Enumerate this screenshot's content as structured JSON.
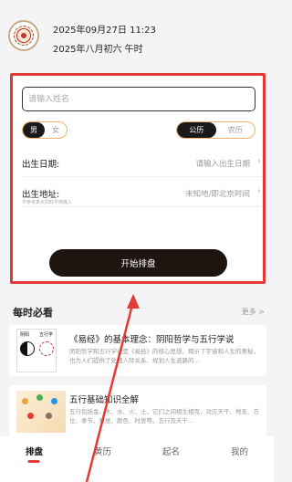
{
  "header": {
    "date_solar": "2025年09月27日 11:23",
    "date_lunar": "2025年八月初六 午时"
  },
  "form": {
    "name_placeholder": "请输入姓名",
    "gender": {
      "options": [
        "男",
        "女"
      ],
      "selected": "男"
    },
    "calendar": {
      "options": [
        "公历",
        "农历"
      ],
      "selected": "公历"
    },
    "birth_date": {
      "label": "出生日期:",
      "value": "请输入出生日期"
    },
    "birth_place": {
      "label": "出生地址:",
      "hint": "不参考真太阳时不用输入",
      "value": "未知地/即北京时间"
    },
    "submit_label": "开始排盘"
  },
  "section": {
    "title": "每时必看",
    "more_label": "更多 >"
  },
  "articles": [
    {
      "thumb_labels": [
        "阴阳",
        "五行学"
      ],
      "title": "《易经》的基本理念：阴阳哲学与五行学说",
      "desc": "阴阳哲学和五行学说是《易经》的核心思想，揭示了宇宙和人生的奥秘，也为人们提供了处理人际关系、规划人生道路的..."
    },
    {
      "title": "五行基础知识全解",
      "desc": "五行包括金、木、水、火、土，它们之间相生相克，对应天干、地支、方位、季节、味觉、颜色、时辰等。五行及天干..."
    }
  ],
  "tabbar": {
    "tabs": [
      "排盘",
      "黄历",
      "起名",
      "我的"
    ],
    "active": "排盘"
  },
  "colors": {
    "highlight_box": "#e53935",
    "segment_border": "#f0b36e",
    "button_bg": "#1e1410"
  },
  "icons": {
    "logo": "bagua-logo",
    "row_arrow": "chevron-right-icon"
  }
}
